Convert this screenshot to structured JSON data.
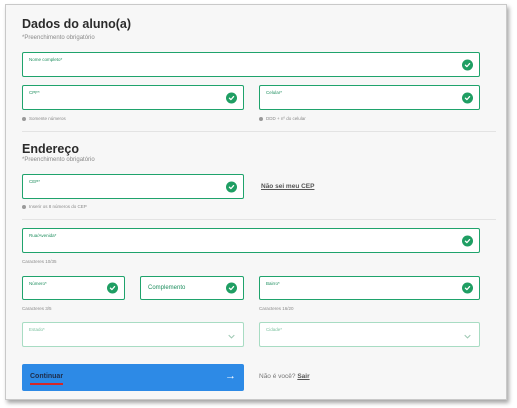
{
  "student": {
    "title": "Dados do aluno(a)",
    "required_note": "*Preenchimento obrigatório",
    "name_label": "Nome completo*",
    "cpf_label": "CPF*",
    "cpf_hint": "Somente números",
    "phone_label": "Celular*",
    "phone_hint": "DDD + nº do celular"
  },
  "address": {
    "title": "Endereço",
    "required_note": "*Preenchimento obrigatório",
    "cep_label": "CEP*",
    "cep_hint": "Inserir os 8 números do CEP",
    "cep_link": "Não sei meu CEP",
    "street_label": "Rua/Avenida*",
    "street_counter": "Caracteres 10/35",
    "number_label": "Número*",
    "number_counter": "Caracteres 3/5",
    "complement_label": "Complemento",
    "district_label": "Bairro*",
    "district_counter": "Caracteres 16/20",
    "state_label": "Estado*",
    "city_label": "Cidade*"
  },
  "footer": {
    "continue_label": "Continuar",
    "continue_arrow": "→",
    "not_you": "Não é você?",
    "logout": "Sair"
  },
  "colors": {
    "accent_green": "#1f9e63",
    "button_blue": "#2d8ae6",
    "underline_red": "#d62828"
  },
  "icons": {
    "valid": "check-circle-icon",
    "dropdown": "chevron-down-icon",
    "hint": "info-dot-icon",
    "continue": "arrow-right-icon"
  }
}
